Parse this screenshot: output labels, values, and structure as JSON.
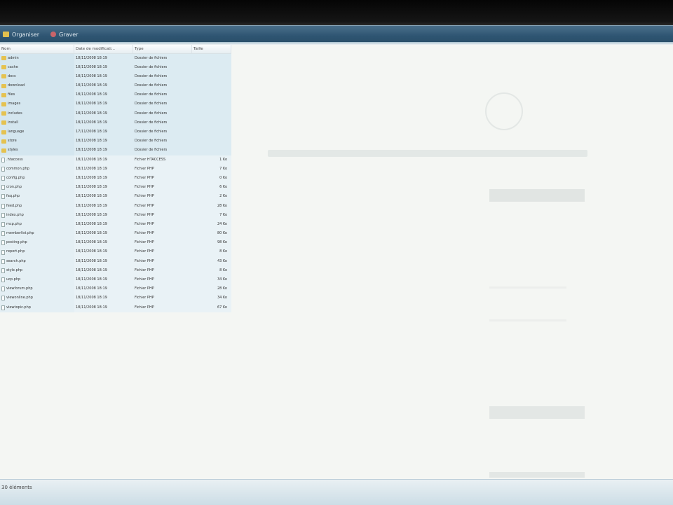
{
  "toolbar": {
    "items": [
      {
        "label": "Organiser",
        "icon": "folder-icon"
      },
      {
        "label": "Graver",
        "icon": "burn-icon"
      }
    ]
  },
  "columns": [
    "Nom",
    "Date de modificati...",
    "Type",
    "Taille"
  ],
  "files": [
    {
      "name": "admin",
      "date": "18/11/2008 18:19",
      "type": "Dossier de fichiers",
      "size": "",
      "kind": "folder"
    },
    {
      "name": "cache",
      "date": "18/11/2008 18:19",
      "type": "Dossier de fichiers",
      "size": "",
      "kind": "folder"
    },
    {
      "name": "docs",
      "date": "18/11/2008 18:19",
      "type": "Dossier de fichiers",
      "size": "",
      "kind": "folder"
    },
    {
      "name": "download",
      "date": "18/11/2008 18:19",
      "type": "Dossier de fichiers",
      "size": "",
      "kind": "folder"
    },
    {
      "name": "files",
      "date": "18/11/2008 18:19",
      "type": "Dossier de fichiers",
      "size": "",
      "kind": "folder"
    },
    {
      "name": "images",
      "date": "18/11/2008 18:19",
      "type": "Dossier de fichiers",
      "size": "",
      "kind": "folder"
    },
    {
      "name": "includes",
      "date": "18/11/2008 18:19",
      "type": "Dossier de fichiers",
      "size": "",
      "kind": "folder"
    },
    {
      "name": "install",
      "date": "18/11/2008 18:19",
      "type": "Dossier de fichiers",
      "size": "",
      "kind": "folder"
    },
    {
      "name": "language",
      "date": "17/11/2008 18:19",
      "type": "Dossier de fichiers",
      "size": "",
      "kind": "folder"
    },
    {
      "name": "store",
      "date": "18/11/2008 18:19",
      "type": "Dossier de fichiers",
      "size": "",
      "kind": "folder"
    },
    {
      "name": "styles",
      "date": "18/11/2008 18:19",
      "type": "Dossier de fichiers",
      "size": "",
      "kind": "folder"
    },
    {
      "name": ".htaccess",
      "date": "18/11/2008 18:19",
      "type": "Fichier HTACCESS",
      "size": "1 Ko",
      "kind": "file"
    },
    {
      "name": "common.php",
      "date": "18/11/2008 18:19",
      "type": "Fichier PHP",
      "size": "7 Ko",
      "kind": "file"
    },
    {
      "name": "config.php",
      "date": "18/11/2008 18:19",
      "type": "Fichier PHP",
      "size": "0 Ko",
      "kind": "file"
    },
    {
      "name": "cron.php",
      "date": "18/11/2008 18:19",
      "type": "Fichier PHP",
      "size": "6 Ko",
      "kind": "file"
    },
    {
      "name": "faq.php",
      "date": "18/11/2008 18:19",
      "type": "Fichier PHP",
      "size": "2 Ko",
      "kind": "file"
    },
    {
      "name": "feed.php",
      "date": "18/11/2008 18:19",
      "type": "Fichier PHP",
      "size": "28 Ko",
      "kind": "file"
    },
    {
      "name": "index.php",
      "date": "18/11/2008 18:19",
      "type": "Fichier PHP",
      "size": "7 Ko",
      "kind": "file"
    },
    {
      "name": "mcp.php",
      "date": "18/11/2008 18:19",
      "type": "Fichier PHP",
      "size": "24 Ko",
      "kind": "file"
    },
    {
      "name": "memberlist.php",
      "date": "18/11/2008 18:19",
      "type": "Fichier PHP",
      "size": "80 Ko",
      "kind": "file"
    },
    {
      "name": "posting.php",
      "date": "18/11/2008 18:19",
      "type": "Fichier PHP",
      "size": "98 Ko",
      "kind": "file"
    },
    {
      "name": "report.php",
      "date": "18/11/2008 18:19",
      "type": "Fichier PHP",
      "size": "8 Ko",
      "kind": "file"
    },
    {
      "name": "search.php",
      "date": "18/11/2008 18:19",
      "type": "Fichier PHP",
      "size": "43 Ko",
      "kind": "file"
    },
    {
      "name": "style.php",
      "date": "18/11/2008 18:19",
      "type": "Fichier PHP",
      "size": "8 Ko",
      "kind": "file"
    },
    {
      "name": "ucp.php",
      "date": "18/11/2008 18:19",
      "type": "Fichier PHP",
      "size": "34 Ko",
      "kind": "file"
    },
    {
      "name": "viewforum.php",
      "date": "18/11/2008 18:19",
      "type": "Fichier PHP",
      "size": "28 Ko",
      "kind": "file"
    },
    {
      "name": "viewonline.php",
      "date": "18/11/2008 18:19",
      "type": "Fichier PHP",
      "size": "34 Ko",
      "kind": "file"
    },
    {
      "name": "viewtopic.php",
      "date": "18/11/2008 18:19",
      "type": "Fichier PHP",
      "size": "67 Ko",
      "kind": "file"
    }
  ],
  "status": {
    "text": "30 éléments"
  }
}
